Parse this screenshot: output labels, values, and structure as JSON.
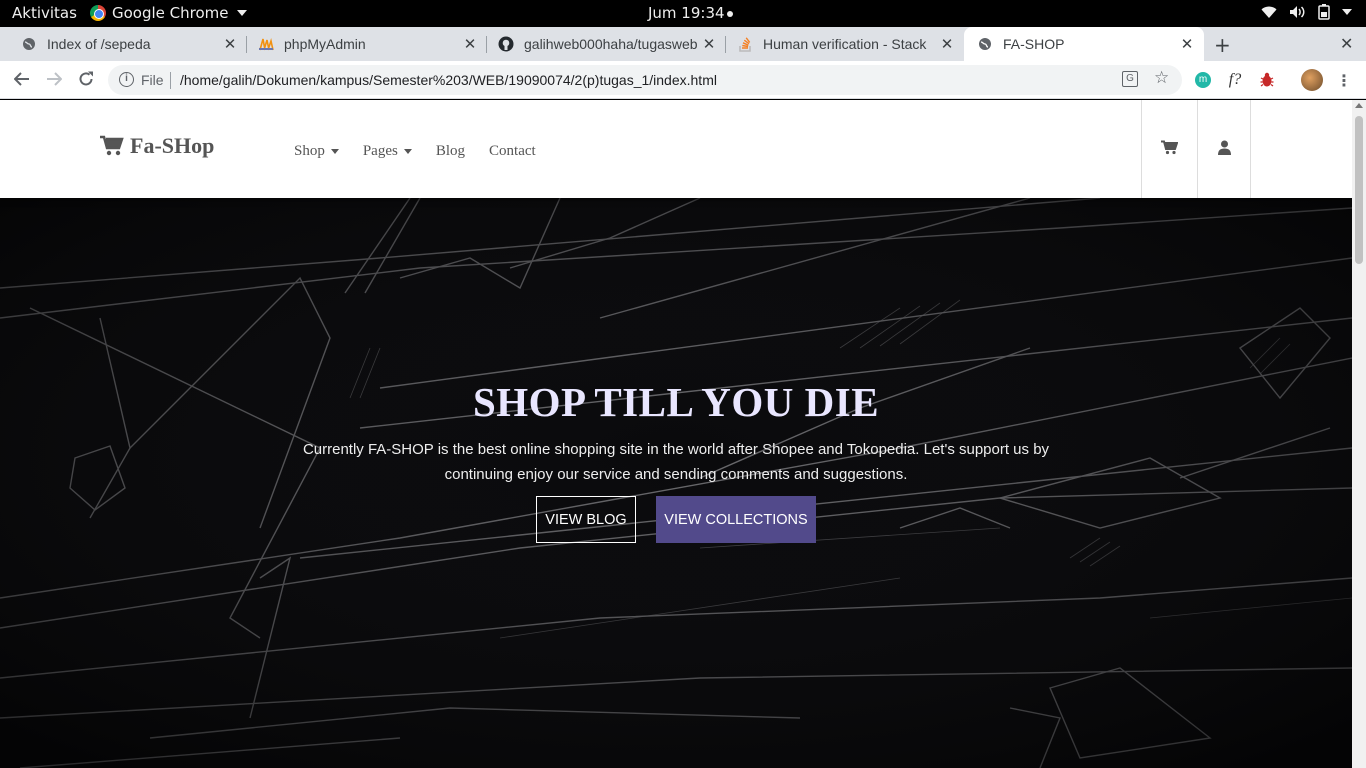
{
  "system_bar": {
    "activities": "Aktivitas",
    "app_name": "Google Chrome",
    "clock": "Jum 19:34"
  },
  "tabs": [
    {
      "title": "Index of /sepeda",
      "icon": "globe-icon"
    },
    {
      "title": "phpMyAdmin",
      "icon": "phpmyadmin-icon"
    },
    {
      "title": "galihweb000haha/tugasweb",
      "icon": "github-icon"
    },
    {
      "title": "Human verification - Stack",
      "icon": "stackoverflow-icon"
    },
    {
      "title": "FA-SHOP",
      "icon": "globe-icon",
      "active": true
    }
  ],
  "omnibox": {
    "scheme_label": "File",
    "url": "/home/galih/Dokumen/kampus/Semester%203/WEB/19090074/2(p)tugas_1/index.html"
  },
  "extensions": [
    "m",
    "f?"
  ],
  "site": {
    "brand": "Fa-SHop",
    "menu": [
      {
        "label": "Shop",
        "dropdown": true
      },
      {
        "label": "Pages",
        "dropdown": true
      },
      {
        "label": "Blog",
        "dropdown": false
      },
      {
        "label": "Contact",
        "dropdown": false
      }
    ]
  },
  "hero": {
    "title": "SHOP TILL YOU DIE",
    "description": "Currently FA-SHOP is the best online shopping site in the world after Shopee and Tokopedia. Let's support us by continuing enjoy our service and sending comments and suggestions.",
    "button_primary": "VIEW BLOG",
    "button_secondary": "VIEW COLLECTIONS"
  },
  "colors": {
    "accent": "#524a8b",
    "hero_title": "#e9e6ff",
    "hero_bg": "#0a0a0c"
  }
}
